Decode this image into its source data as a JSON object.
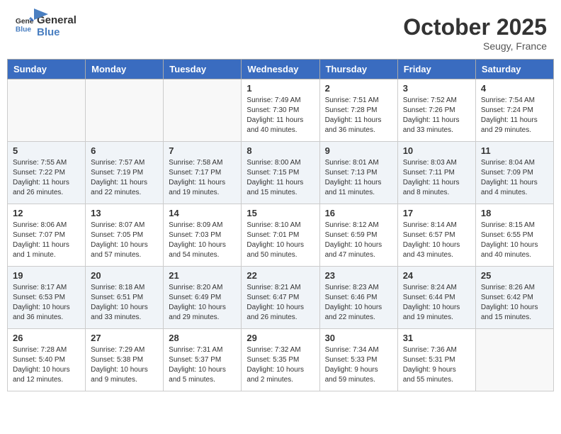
{
  "header": {
    "logo_line1": "General",
    "logo_line2": "Blue",
    "month": "October 2025",
    "location": "Seugy, France"
  },
  "weekdays": [
    "Sunday",
    "Monday",
    "Tuesday",
    "Wednesday",
    "Thursday",
    "Friday",
    "Saturday"
  ],
  "weeks": [
    [
      {
        "day": "",
        "content": ""
      },
      {
        "day": "",
        "content": ""
      },
      {
        "day": "",
        "content": ""
      },
      {
        "day": "1",
        "content": "Sunrise: 7:49 AM\nSunset: 7:30 PM\nDaylight: 11 hours\nand 40 minutes."
      },
      {
        "day": "2",
        "content": "Sunrise: 7:51 AM\nSunset: 7:28 PM\nDaylight: 11 hours\nand 36 minutes."
      },
      {
        "day": "3",
        "content": "Sunrise: 7:52 AM\nSunset: 7:26 PM\nDaylight: 11 hours\nand 33 minutes."
      },
      {
        "day": "4",
        "content": "Sunrise: 7:54 AM\nSunset: 7:24 PM\nDaylight: 11 hours\nand 29 minutes."
      }
    ],
    [
      {
        "day": "5",
        "content": "Sunrise: 7:55 AM\nSunset: 7:22 PM\nDaylight: 11 hours\nand 26 minutes."
      },
      {
        "day": "6",
        "content": "Sunrise: 7:57 AM\nSunset: 7:19 PM\nDaylight: 11 hours\nand 22 minutes."
      },
      {
        "day": "7",
        "content": "Sunrise: 7:58 AM\nSunset: 7:17 PM\nDaylight: 11 hours\nand 19 minutes."
      },
      {
        "day": "8",
        "content": "Sunrise: 8:00 AM\nSunset: 7:15 PM\nDaylight: 11 hours\nand 15 minutes."
      },
      {
        "day": "9",
        "content": "Sunrise: 8:01 AM\nSunset: 7:13 PM\nDaylight: 11 hours\nand 11 minutes."
      },
      {
        "day": "10",
        "content": "Sunrise: 8:03 AM\nSunset: 7:11 PM\nDaylight: 11 hours\nand 8 minutes."
      },
      {
        "day": "11",
        "content": "Sunrise: 8:04 AM\nSunset: 7:09 PM\nDaylight: 11 hours\nand 4 minutes."
      }
    ],
    [
      {
        "day": "12",
        "content": "Sunrise: 8:06 AM\nSunset: 7:07 PM\nDaylight: 11 hours\nand 1 minute."
      },
      {
        "day": "13",
        "content": "Sunrise: 8:07 AM\nSunset: 7:05 PM\nDaylight: 10 hours\nand 57 minutes."
      },
      {
        "day": "14",
        "content": "Sunrise: 8:09 AM\nSunset: 7:03 PM\nDaylight: 10 hours\nand 54 minutes."
      },
      {
        "day": "15",
        "content": "Sunrise: 8:10 AM\nSunset: 7:01 PM\nDaylight: 10 hours\nand 50 minutes."
      },
      {
        "day": "16",
        "content": "Sunrise: 8:12 AM\nSunset: 6:59 PM\nDaylight: 10 hours\nand 47 minutes."
      },
      {
        "day": "17",
        "content": "Sunrise: 8:14 AM\nSunset: 6:57 PM\nDaylight: 10 hours\nand 43 minutes."
      },
      {
        "day": "18",
        "content": "Sunrise: 8:15 AM\nSunset: 6:55 PM\nDaylight: 10 hours\nand 40 minutes."
      }
    ],
    [
      {
        "day": "19",
        "content": "Sunrise: 8:17 AM\nSunset: 6:53 PM\nDaylight: 10 hours\nand 36 minutes."
      },
      {
        "day": "20",
        "content": "Sunrise: 8:18 AM\nSunset: 6:51 PM\nDaylight: 10 hours\nand 33 minutes."
      },
      {
        "day": "21",
        "content": "Sunrise: 8:20 AM\nSunset: 6:49 PM\nDaylight: 10 hours\nand 29 minutes."
      },
      {
        "day": "22",
        "content": "Sunrise: 8:21 AM\nSunset: 6:47 PM\nDaylight: 10 hours\nand 26 minutes."
      },
      {
        "day": "23",
        "content": "Sunrise: 8:23 AM\nSunset: 6:46 PM\nDaylight: 10 hours\nand 22 minutes."
      },
      {
        "day": "24",
        "content": "Sunrise: 8:24 AM\nSunset: 6:44 PM\nDaylight: 10 hours\nand 19 minutes."
      },
      {
        "day": "25",
        "content": "Sunrise: 8:26 AM\nSunset: 6:42 PM\nDaylight: 10 hours\nand 15 minutes."
      }
    ],
    [
      {
        "day": "26",
        "content": "Sunrise: 7:28 AM\nSunset: 5:40 PM\nDaylight: 10 hours\nand 12 minutes."
      },
      {
        "day": "27",
        "content": "Sunrise: 7:29 AM\nSunset: 5:38 PM\nDaylight: 10 hours\nand 9 minutes."
      },
      {
        "day": "28",
        "content": "Sunrise: 7:31 AM\nSunset: 5:37 PM\nDaylight: 10 hours\nand 5 minutes."
      },
      {
        "day": "29",
        "content": "Sunrise: 7:32 AM\nSunset: 5:35 PM\nDaylight: 10 hours\nand 2 minutes."
      },
      {
        "day": "30",
        "content": "Sunrise: 7:34 AM\nSunset: 5:33 PM\nDaylight: 9 hours\nand 59 minutes."
      },
      {
        "day": "31",
        "content": "Sunrise: 7:36 AM\nSunset: 5:31 PM\nDaylight: 9 hours\nand 55 minutes."
      },
      {
        "day": "",
        "content": ""
      }
    ]
  ]
}
